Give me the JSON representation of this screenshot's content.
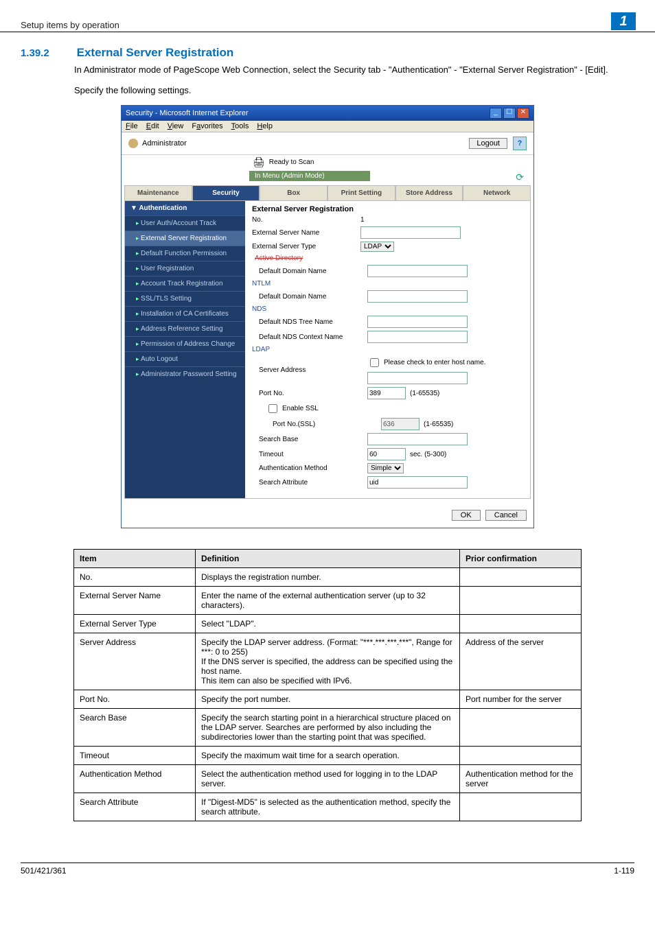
{
  "header": {
    "breadcrumb": "Setup items by operation",
    "chip": "1"
  },
  "section": {
    "number": "1.39.2",
    "title": "External Server Registration"
  },
  "intro": {
    "p1": "In Administrator mode of PageScope Web Connection, select the Security tab - \"Authentication\" - \"External Server Registration\" - [Edit].",
    "p2": "Specify the following settings."
  },
  "shot": {
    "window_title": "Security - Microsoft Internet Explorer",
    "menu": {
      "file": "File",
      "edit": "Edit",
      "view": "View",
      "favorites": "Favorites",
      "tools": "Tools",
      "help": "Help"
    },
    "admin_label": "Administrator",
    "logout": "Logout",
    "ready": "Ready to Scan",
    "mode": "In Menu (Admin Mode)",
    "tabs": {
      "maintenance": "Maintenance",
      "security": "Security",
      "box": "Box",
      "print": "Print Setting",
      "store": "Store Address",
      "network": "Network"
    },
    "sidebar": {
      "heading": "Authentication",
      "items": [
        "User Auth/Account Track",
        "External Server Registration",
        "Default Function Permission",
        "User Registration",
        "Account Track Registration",
        "SSL/TLS Setting",
        "Installation of CA Certificates",
        "Address Reference Setting",
        "Permission of Address Change",
        "Auto Logout",
        "Administrator Password Setting"
      ]
    },
    "form": {
      "title": "External Server Registration",
      "no_label": "No.",
      "no_value": "1",
      "name_label": "External Server Name",
      "name_value": "",
      "type_label": "External Server Type",
      "type_value": "LDAP",
      "ad_head": "Active Directory",
      "ad_domain_label": "Default Domain Name",
      "ad_domain_value": "",
      "ntlm_head": "NTLM",
      "ntlm_domain_label": "Default Domain Name",
      "ntlm_domain_value": "",
      "nds_head": "NDS",
      "nds_tree_label": "Default NDS Tree Name",
      "nds_tree_value": "",
      "nds_ctx_label": "Default NDS Context Name",
      "nds_ctx_value": "",
      "ldap_head": "LDAP",
      "addr_label": "Server Address",
      "addr_check": "Please check to enter host name.",
      "addr_value": "",
      "port_label": "Port No.",
      "port_value": "389",
      "port_range": "(1-65535)",
      "enable_ssl": "Enable SSL",
      "port_ssl_label": "Port No.(SSL)",
      "port_ssl_value": "636",
      "port_ssl_range": "(1-65535)",
      "search_base_label": "Search Base",
      "search_base_value": "",
      "timeout_label": "Timeout",
      "timeout_value": "60",
      "timeout_unit": "sec. (5-300)",
      "auth_label": "Authentication Method",
      "auth_value": "Simple",
      "search_attr_label": "Search Attribute",
      "search_attr_value": "uid",
      "ok": "OK",
      "cancel": "Cancel"
    }
  },
  "defs": {
    "headers": {
      "item": "Item",
      "def": "Definition",
      "prior": "Prior confirmation"
    },
    "rows": [
      {
        "item": "No.",
        "def": "Displays the registration number.",
        "prior": ""
      },
      {
        "item": "External Server Name",
        "def": "Enter the name of the external authentication server (up to 32 characters).",
        "prior": ""
      },
      {
        "item": "External Server Type",
        "def": "Select \"LDAP\".",
        "prior": ""
      },
      {
        "item": "Server Address",
        "def": "Specify the LDAP server address. (Format: \"***.***.***.***\", Range for ***: 0 to 255)\nIf the DNS server is specified, the address can be specified using the host name.\nThis item can also be specified with IPv6.",
        "prior": "Address of the server"
      },
      {
        "item": "Port No.",
        "def": "Specify the port number.",
        "prior": "Port number for the server"
      },
      {
        "item": "Search Base",
        "def": "Specify the search starting point in a hierarchical structure placed on the LDAP server. Searches are performed by also including the subdirectories lower than the starting point that was specified.",
        "prior": ""
      },
      {
        "item": "Timeout",
        "def": "Specify the maximum wait time for a search operation.",
        "prior": ""
      },
      {
        "item": "Authentication Method",
        "def": "Select the authentication method used for logging in to the LDAP server.",
        "prior": "Authentication method for the server"
      },
      {
        "item": "Search Attribute",
        "def": "If \"Digest-MD5\" is selected as the authentication method, specify the search attribute.",
        "prior": ""
      }
    ]
  },
  "footer": {
    "left": "501/421/361",
    "right": "1-119"
  }
}
